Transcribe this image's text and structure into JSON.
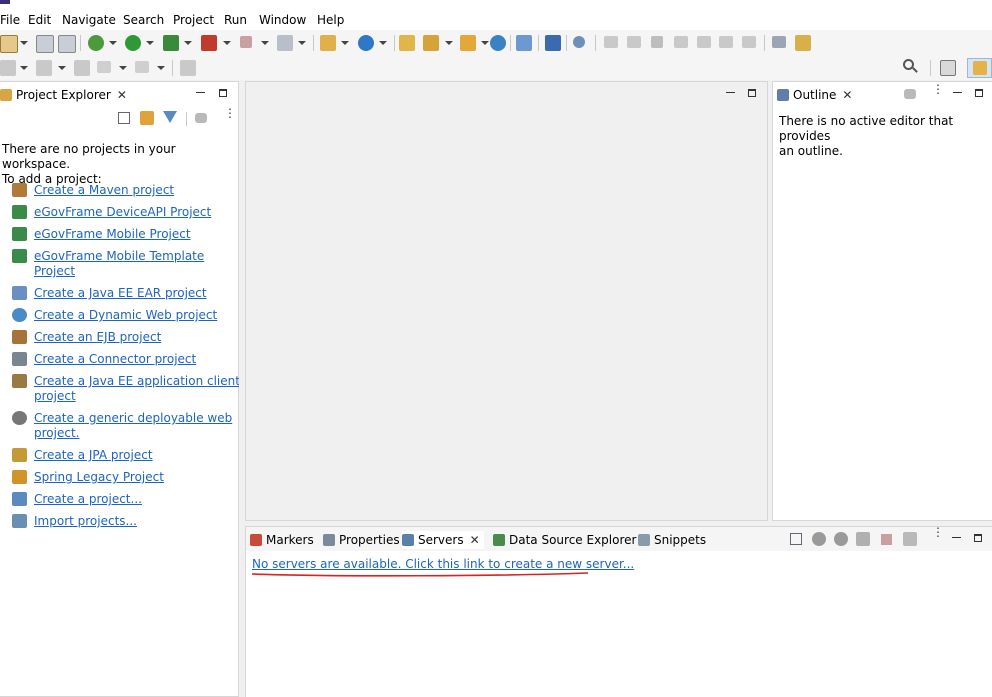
{
  "menu": [
    "File",
    "Edit",
    "Navigate",
    "Search",
    "Project",
    "Run",
    "Window",
    "Help"
  ],
  "project_explorer": {
    "title": "Project Explorer",
    "message_line1": "There are no projects in your workspace.",
    "message_line2": "To add a project:",
    "links": [
      {
        "label": "Create a Maven project",
        "icon": "maven-icon",
        "color": "#8a5a2b"
      },
      {
        "label": "eGovFrame DeviceAPI Project",
        "icon": "egov-device-icon",
        "color": "#2f7d3a"
      },
      {
        "label": "eGovFrame Mobile Project",
        "icon": "egov-mobile-icon",
        "color": "#2f7d3a"
      },
      {
        "label": "eGovFrame Mobile Template\nProject",
        "icon": "egov-template-icon",
        "color": "#2f7d3a"
      },
      {
        "label": "Create a Java EE EAR project",
        "icon": "ear-project-icon",
        "color": "#5b7fb8"
      },
      {
        "label": "Create a Dynamic Web project",
        "icon": "web-project-icon",
        "color": "#3d7fbf"
      },
      {
        "label": "Create an EJB project",
        "icon": "ejb-project-icon",
        "color": "#a06a2c"
      },
      {
        "label": "Create a Connector project",
        "icon": "connector-project-icon",
        "color": "#6f7a86"
      },
      {
        "label": "Create a Java EE application client\nproject",
        "icon": "app-client-icon",
        "color": "#8b6d3a"
      },
      {
        "label": "Create a generic deployable web\nproject.",
        "icon": "deployable-web-icon",
        "color": "#6a6a6a"
      },
      {
        "label": "Create a JPA project",
        "icon": "jpa-project-icon",
        "color": "#b48a2a"
      },
      {
        "label": "Spring Legacy Project",
        "icon": "spring-project-icon",
        "color": "#c88a1f"
      },
      {
        "label": "Create a project...",
        "icon": "new-project-icon",
        "color": "#4a7fb6"
      },
      {
        "label": "Import projects...",
        "icon": "import-projects-icon",
        "color": "#5a7fa8"
      }
    ]
  },
  "outline": {
    "title": "Outline",
    "message_line1": "There is no active editor that provides",
    "message_line2": "an outline."
  },
  "bottom_tabs": {
    "markers": "Markers",
    "properties": "Properties",
    "servers": "Servers",
    "data_source_explorer": "Data Source Explorer",
    "snippets": "Snippets"
  },
  "servers": {
    "link": "No servers are available. Click this link to create a new server..."
  },
  "colors": {
    "link": "#1d64c1",
    "annotation_red": "#e0201a"
  }
}
